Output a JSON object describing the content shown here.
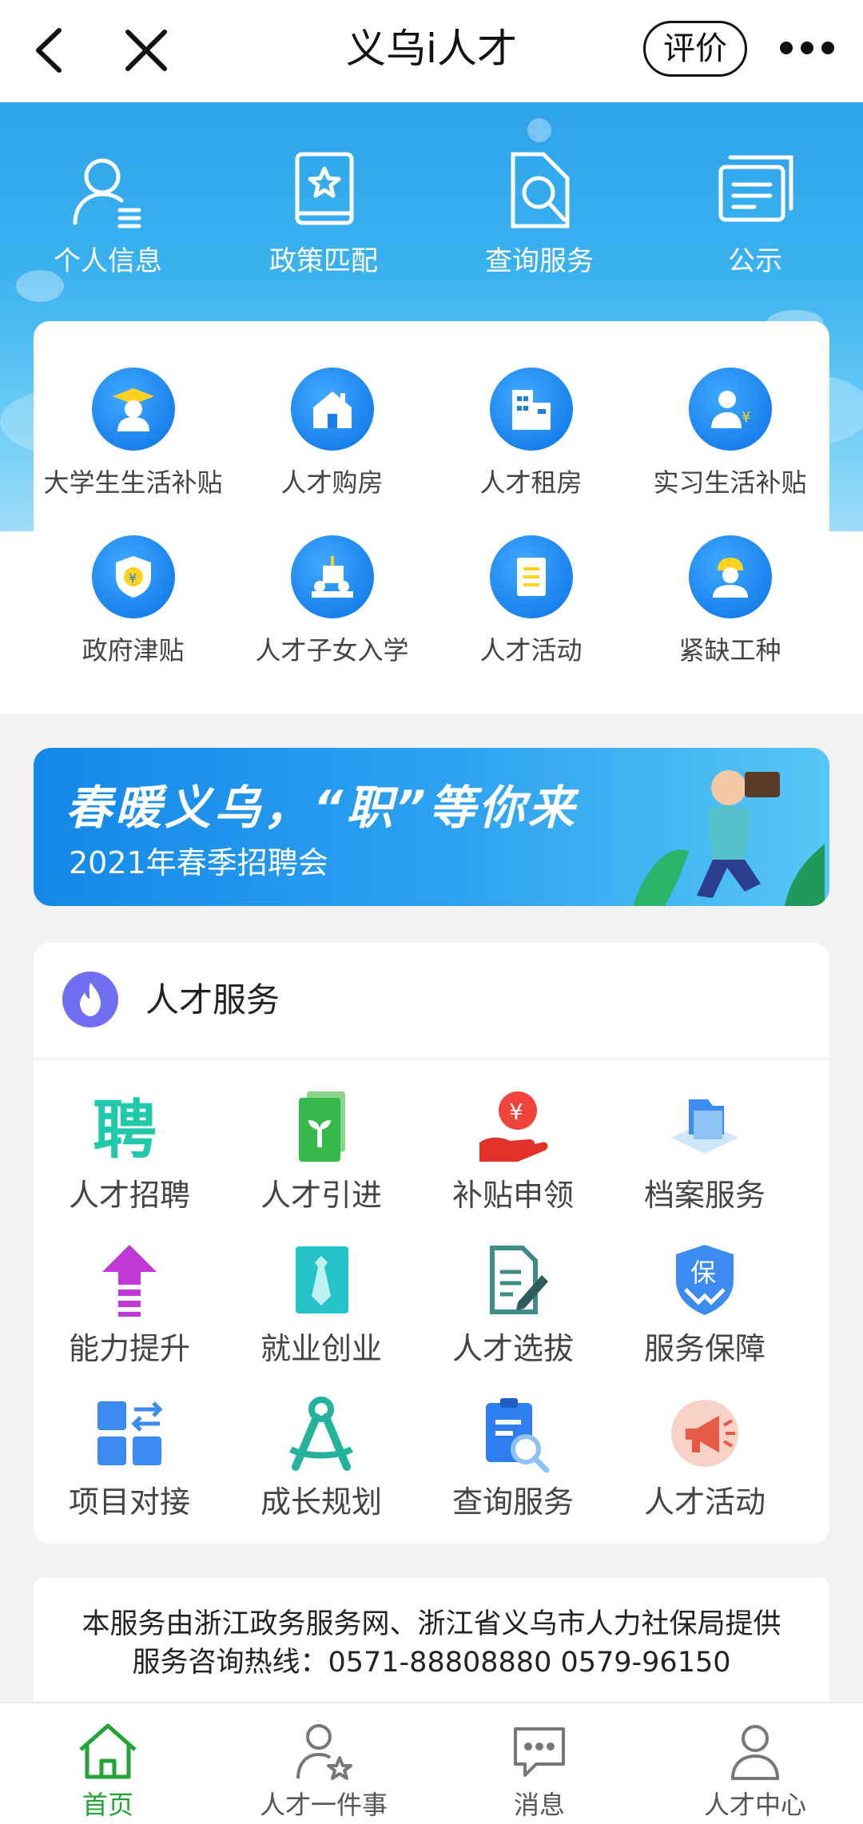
{
  "nav": {
    "title": "义乌i人才",
    "rate_label": "评价"
  },
  "hero": {
    "items": [
      {
        "label": "个人信息",
        "icon": "person-list-icon"
      },
      {
        "label": "政策匹配",
        "icon": "star-book-icon"
      },
      {
        "label": "查询服务",
        "icon": "search-doc-icon"
      },
      {
        "label": "公示",
        "icon": "notice-icon"
      }
    ]
  },
  "subsidies": {
    "items": [
      {
        "label": "大学生生活补贴",
        "icon": "graduate-icon"
      },
      {
        "label": "人才购房",
        "icon": "house-icon"
      },
      {
        "label": "人才租房",
        "icon": "building-icon"
      },
      {
        "label": "实习生活补贴",
        "icon": "intern-yen-icon"
      },
      {
        "label": "政府津贴",
        "icon": "shield-yen-icon"
      },
      {
        "label": "人才子女入学",
        "icon": "school-icon"
      },
      {
        "label": "人才活动",
        "icon": "activity-doc-icon"
      },
      {
        "label": "紧缺工种",
        "icon": "worker-icon"
      }
    ]
  },
  "banner": {
    "headline": "春暖义乌，“职”等你来",
    "subline": "2021年春季招聘会"
  },
  "services": {
    "title": "人才服务",
    "items": [
      {
        "label": "人才招聘",
        "icon": "recruit-icon",
        "color": "#1fc9a9"
      },
      {
        "label": "人才引进",
        "icon": "sprout-icon",
        "color": "#3cbf4b"
      },
      {
        "label": "补贴申领",
        "icon": "yen-hand-icon",
        "color": "#f0433a"
      },
      {
        "label": "档案服务",
        "icon": "folder-icon",
        "color": "#5aa9f2"
      },
      {
        "label": "能力提升",
        "icon": "arrow-up-icon",
        "color": "#c039d6"
      },
      {
        "label": "就业创业",
        "icon": "tie-icon",
        "color": "#26c3c9"
      },
      {
        "label": "人才选拔",
        "icon": "checklist-icon",
        "color": "#3d8d86"
      },
      {
        "label": "服务保障",
        "icon": "guarantee-icon",
        "color": "#3c8bf0"
      },
      {
        "label": "项目对接",
        "icon": "grid-swap-icon",
        "color": "#3c8bf0"
      },
      {
        "label": "成长规划",
        "icon": "compass-icon",
        "color": "#23b39a"
      },
      {
        "label": "查询服务",
        "icon": "clipboard-search-icon",
        "color": "#2f7ef0"
      },
      {
        "label": "人才活动",
        "icon": "megaphone-icon",
        "color": "#e65b48"
      }
    ]
  },
  "footer": {
    "line1": "本服务由浙江政务服务网、浙江省义乌市人力社保局提供",
    "line2": "服务咨询热线：0571-88808880 0579-96150"
  },
  "tabbar": {
    "items": [
      {
        "label": "首页",
        "icon": "home-icon",
        "active": true
      },
      {
        "label": "人才一件事",
        "icon": "person-star-icon",
        "active": false
      },
      {
        "label": "消息",
        "icon": "message-icon",
        "active": false
      },
      {
        "label": "人才中心",
        "icon": "user-icon",
        "active": false
      }
    ],
    "active_color": "#21a336"
  }
}
